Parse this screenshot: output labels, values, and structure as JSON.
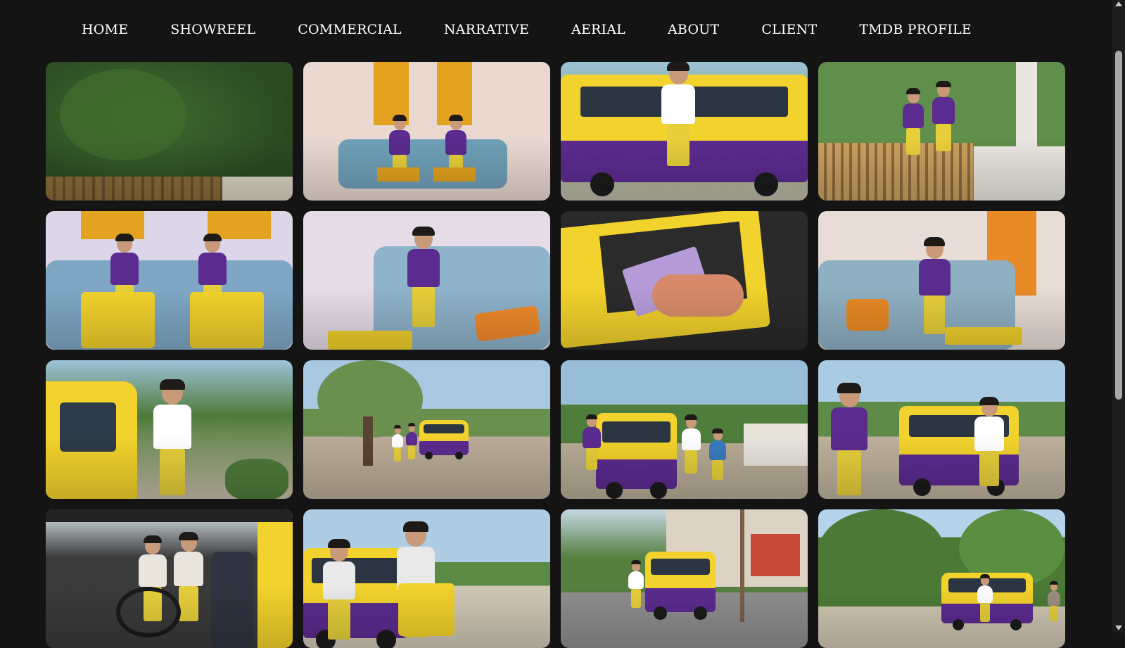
{
  "nav": {
    "items": [
      {
        "label": "HOME",
        "key": "home"
      },
      {
        "label": "SHOWREEL",
        "key": "showreel"
      },
      {
        "label": "COMMERCIAL",
        "key": "commercial"
      },
      {
        "label": "NARRATIVE",
        "key": "narrative"
      },
      {
        "label": "AERIAL",
        "key": "aerial"
      },
      {
        "label": "ABOUT",
        "key": "about"
      },
      {
        "label": "CLIENT",
        "key": "client"
      },
      {
        "label": "TMDB PROFILE",
        "key": "tmdb-profile"
      }
    ]
  },
  "colors": {
    "background": "#141414",
    "nav_text": "#ffffff",
    "accent_purple": "#5b2b8f",
    "accent_yellow": "#f2d22c"
  },
  "gallery": {
    "thumbnails": [
      {
        "scene": "garden-foliage",
        "palette": [
          "#3f6b2e",
          "#2b4a22",
          "#8a6a3a",
          "#d9d2c3"
        ]
      },
      {
        "scene": "living-room-duo",
        "palette": [
          "#e8d8d0",
          "#6fa0b8",
          "#e3a21f",
          "#5b2b8f"
        ]
      },
      {
        "scene": "yellow-van-performer",
        "palette": [
          "#9ec3d9",
          "#f2d22c",
          "#5b2b8f",
          "#ffffff"
        ]
      },
      {
        "scene": "garden-fence-duo",
        "palette": [
          "#5f8f4a",
          "#c9a060",
          "#5b2b8f",
          "#e9e6e0"
        ]
      },
      {
        "scene": "sofa-yellow-cases",
        "palette": [
          "#dcd6e8",
          "#7fa7c4",
          "#f2d22c",
          "#5b2b8f"
        ]
      },
      {
        "scene": "sofa-girl-phone",
        "palette": [
          "#e6dce8",
          "#8fb3cb",
          "#f08a2a",
          "#5b2b8f"
        ]
      },
      {
        "scene": "case-card-closeup",
        "palette": [
          "#2a2a2a",
          "#f2d22c",
          "#d78a6a",
          "#b59cd8"
        ]
      },
      {
        "scene": "sofa-boy-phone",
        "palette": [
          "#e7ddd6",
          "#8fb0c3",
          "#e88a25",
          "#5b2b8f"
        ]
      },
      {
        "scene": "singer-by-van",
        "palette": [
          "#4f7a3a",
          "#f2d22c",
          "#ffffff",
          "#2a2a2a"
        ]
      },
      {
        "scene": "street-van-wide",
        "palette": [
          "#a7c8e0",
          "#6b8f4f",
          "#b9ab97",
          "#5b2b8f"
        ]
      },
      {
        "scene": "village-van-crowd",
        "palette": [
          "#98bdd8",
          "#4f7d3c",
          "#f2d22c",
          "#5b2b8f"
        ]
      },
      {
        "scene": "dancer-and-van",
        "palette": [
          "#a9cbe3",
          "#5e8c48",
          "#5b2b8f",
          "#f2d22c"
        ]
      },
      {
        "scene": "van-interior",
        "palette": [
          "#3a3a3a",
          "#f2d22c",
          "#e9e4dc",
          "#6d4c3a"
        ]
      },
      {
        "scene": "street-duo-case",
        "palette": [
          "#aecde5",
          "#5b8a45",
          "#f2d22c",
          "#e9e9e9"
        ]
      },
      {
        "scene": "village-road-van",
        "palette": [
          "#c5d7e3",
          "#567f40",
          "#f2d22c",
          "#7a5e4a"
        ]
      },
      {
        "scene": "park-van-wide",
        "palette": [
          "#b5d3ea",
          "#4c7a36",
          "#f2d22c",
          "#5b2b8f"
        ]
      }
    ]
  }
}
